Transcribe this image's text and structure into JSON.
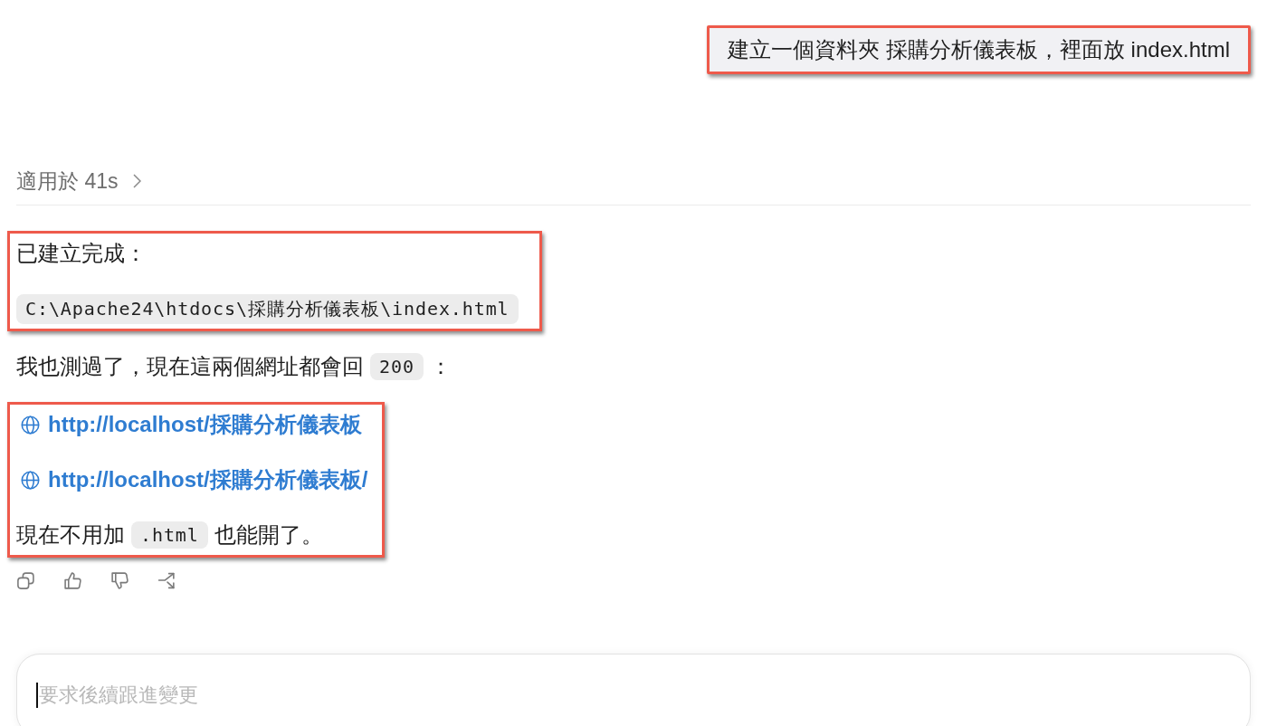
{
  "user_message": {
    "text": "建立一個資料夾 採購分析儀表板，裡面放 index.html",
    "highlighted": true
  },
  "thinking": {
    "label": "適用於 41s",
    "expanded": false
  },
  "response": {
    "blocks": [
      {
        "highlighted": true,
        "lines": [
          {
            "kind": "paragraph",
            "parts": [
              {
                "kind": "text",
                "text": "已建立完成："
              }
            ]
          },
          {
            "kind": "paragraph",
            "parts": [
              {
                "kind": "code",
                "text": "C:\\Apache24\\htdocs\\採購分析儀表板\\index.html"
              }
            ]
          }
        ]
      },
      {
        "highlighted": false,
        "lines": [
          {
            "kind": "paragraph",
            "parts": [
              {
                "kind": "text",
                "text": "我也測過了，現在這兩個網址都會回"
              },
              {
                "kind": "code",
                "text": "200"
              },
              {
                "kind": "text",
                "text": "："
              }
            ]
          }
        ]
      },
      {
        "highlighted": true,
        "lines": [
          {
            "kind": "link",
            "text": "http://localhost/採購分析儀表板"
          },
          {
            "kind": "link",
            "text": "http://localhost/採購分析儀表板/"
          },
          {
            "kind": "paragraph",
            "parts": [
              {
                "kind": "text",
                "text": "現在不用加"
              },
              {
                "kind": "code",
                "text": ".html"
              },
              {
                "kind": "text",
                "text": "也能開了。"
              }
            ]
          }
        ]
      }
    ]
  },
  "composer": {
    "placeholder": "要求後續跟進變更"
  }
}
